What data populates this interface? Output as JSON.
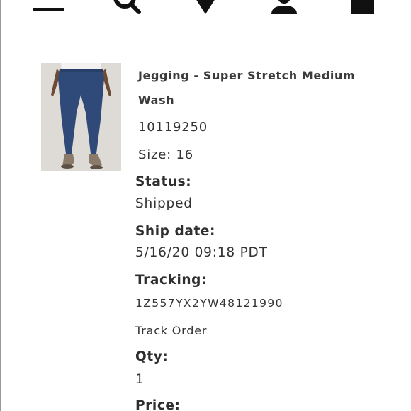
{
  "header": {
    "icons": [
      "menu-icon",
      "search-icon",
      "location-icon",
      "account-icon",
      "bag-icon"
    ]
  },
  "product": {
    "title_line1": "Jegging - Super Stretch Medium",
    "title_line2": "Wash",
    "sku": "10119250",
    "size": "Size: 16",
    "image_icon": "jeans-model-photo"
  },
  "order": {
    "status_label": "Status:",
    "status_value": "Shipped",
    "ship_date_label": "Ship date:",
    "ship_date_value": "5/16/20 09:18 PDT",
    "tracking_label": "Tracking:",
    "tracking_value": "1Z557YX2YW48121990",
    "track_order_link": "Track Order",
    "qty_label": "Qty:",
    "qty_value": "1",
    "price_label": "Price:"
  },
  "colors": {
    "icon": "#111111",
    "text": "#333333",
    "divider": "#d0d0d0",
    "denim": "#2f4a78"
  }
}
